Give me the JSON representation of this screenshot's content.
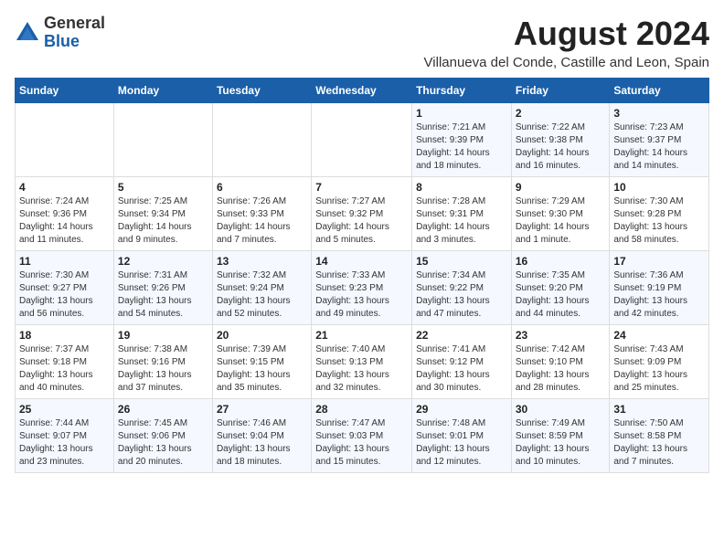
{
  "logo": {
    "general": "General",
    "blue": "Blue"
  },
  "title": "August 2024",
  "location": "Villanueva del Conde, Castille and Leon, Spain",
  "days_header": [
    "Sunday",
    "Monday",
    "Tuesday",
    "Wednesday",
    "Thursday",
    "Friday",
    "Saturday"
  ],
  "weeks": [
    [
      {
        "day": "",
        "info": ""
      },
      {
        "day": "",
        "info": ""
      },
      {
        "day": "",
        "info": ""
      },
      {
        "day": "",
        "info": ""
      },
      {
        "day": "1",
        "info": "Sunrise: 7:21 AM\nSunset: 9:39 PM\nDaylight: 14 hours\nand 18 minutes."
      },
      {
        "day": "2",
        "info": "Sunrise: 7:22 AM\nSunset: 9:38 PM\nDaylight: 14 hours\nand 16 minutes."
      },
      {
        "day": "3",
        "info": "Sunrise: 7:23 AM\nSunset: 9:37 PM\nDaylight: 14 hours\nand 14 minutes."
      }
    ],
    [
      {
        "day": "4",
        "info": "Sunrise: 7:24 AM\nSunset: 9:36 PM\nDaylight: 14 hours\nand 11 minutes."
      },
      {
        "day": "5",
        "info": "Sunrise: 7:25 AM\nSunset: 9:34 PM\nDaylight: 14 hours\nand 9 minutes."
      },
      {
        "day": "6",
        "info": "Sunrise: 7:26 AM\nSunset: 9:33 PM\nDaylight: 14 hours\nand 7 minutes."
      },
      {
        "day": "7",
        "info": "Sunrise: 7:27 AM\nSunset: 9:32 PM\nDaylight: 14 hours\nand 5 minutes."
      },
      {
        "day": "8",
        "info": "Sunrise: 7:28 AM\nSunset: 9:31 PM\nDaylight: 14 hours\nand 3 minutes."
      },
      {
        "day": "9",
        "info": "Sunrise: 7:29 AM\nSunset: 9:30 PM\nDaylight: 14 hours\nand 1 minute."
      },
      {
        "day": "10",
        "info": "Sunrise: 7:30 AM\nSunset: 9:28 PM\nDaylight: 13 hours\nand 58 minutes."
      }
    ],
    [
      {
        "day": "11",
        "info": "Sunrise: 7:30 AM\nSunset: 9:27 PM\nDaylight: 13 hours\nand 56 minutes."
      },
      {
        "day": "12",
        "info": "Sunrise: 7:31 AM\nSunset: 9:26 PM\nDaylight: 13 hours\nand 54 minutes."
      },
      {
        "day": "13",
        "info": "Sunrise: 7:32 AM\nSunset: 9:24 PM\nDaylight: 13 hours\nand 52 minutes."
      },
      {
        "day": "14",
        "info": "Sunrise: 7:33 AM\nSunset: 9:23 PM\nDaylight: 13 hours\nand 49 minutes."
      },
      {
        "day": "15",
        "info": "Sunrise: 7:34 AM\nSunset: 9:22 PM\nDaylight: 13 hours\nand 47 minutes."
      },
      {
        "day": "16",
        "info": "Sunrise: 7:35 AM\nSunset: 9:20 PM\nDaylight: 13 hours\nand 44 minutes."
      },
      {
        "day": "17",
        "info": "Sunrise: 7:36 AM\nSunset: 9:19 PM\nDaylight: 13 hours\nand 42 minutes."
      }
    ],
    [
      {
        "day": "18",
        "info": "Sunrise: 7:37 AM\nSunset: 9:18 PM\nDaylight: 13 hours\nand 40 minutes."
      },
      {
        "day": "19",
        "info": "Sunrise: 7:38 AM\nSunset: 9:16 PM\nDaylight: 13 hours\nand 37 minutes."
      },
      {
        "day": "20",
        "info": "Sunrise: 7:39 AM\nSunset: 9:15 PM\nDaylight: 13 hours\nand 35 minutes."
      },
      {
        "day": "21",
        "info": "Sunrise: 7:40 AM\nSunset: 9:13 PM\nDaylight: 13 hours\nand 32 minutes."
      },
      {
        "day": "22",
        "info": "Sunrise: 7:41 AM\nSunset: 9:12 PM\nDaylight: 13 hours\nand 30 minutes."
      },
      {
        "day": "23",
        "info": "Sunrise: 7:42 AM\nSunset: 9:10 PM\nDaylight: 13 hours\nand 28 minutes."
      },
      {
        "day": "24",
        "info": "Sunrise: 7:43 AM\nSunset: 9:09 PM\nDaylight: 13 hours\nand 25 minutes."
      }
    ],
    [
      {
        "day": "25",
        "info": "Sunrise: 7:44 AM\nSunset: 9:07 PM\nDaylight: 13 hours\nand 23 minutes."
      },
      {
        "day": "26",
        "info": "Sunrise: 7:45 AM\nSunset: 9:06 PM\nDaylight: 13 hours\nand 20 minutes."
      },
      {
        "day": "27",
        "info": "Sunrise: 7:46 AM\nSunset: 9:04 PM\nDaylight: 13 hours\nand 18 minutes."
      },
      {
        "day": "28",
        "info": "Sunrise: 7:47 AM\nSunset: 9:03 PM\nDaylight: 13 hours\nand 15 minutes."
      },
      {
        "day": "29",
        "info": "Sunrise: 7:48 AM\nSunset: 9:01 PM\nDaylight: 13 hours\nand 12 minutes."
      },
      {
        "day": "30",
        "info": "Sunrise: 7:49 AM\nSunset: 8:59 PM\nDaylight: 13 hours\nand 10 minutes."
      },
      {
        "day": "31",
        "info": "Sunrise: 7:50 AM\nSunset: 8:58 PM\nDaylight: 13 hours\nand 7 minutes."
      }
    ]
  ]
}
